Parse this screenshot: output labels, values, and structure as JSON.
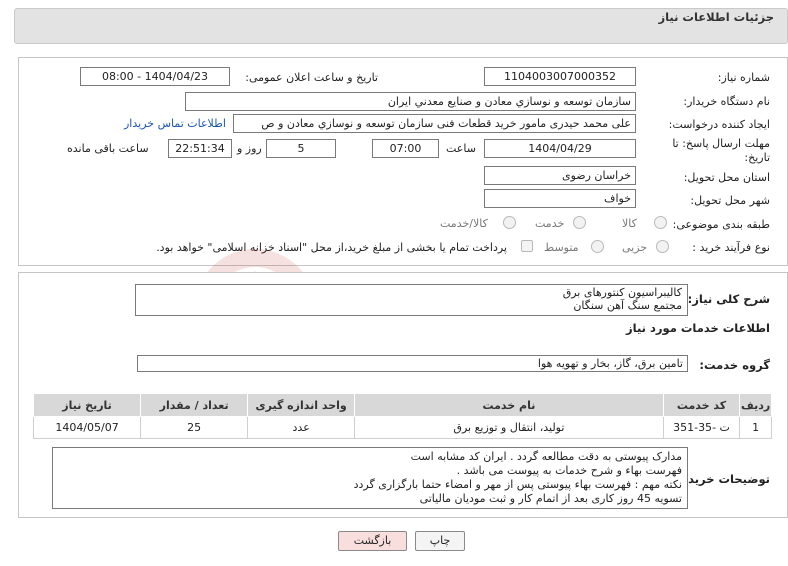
{
  "header": {
    "title": "جزئیات اطلاعات نیاز"
  },
  "need_info": {
    "need_number_label": "شماره نیاز:",
    "need_number": "1104003007000352",
    "announce_label": "تاریخ و ساعت اعلان عمومی:",
    "announce_value": "1404/04/23 - 08:00",
    "buyer_org_label": "نام دستگاه خریدار:",
    "buyer_org": "سازمان توسعه و نوسازي معادن و صنايع معدني ايران",
    "creator_label": "ایجاد کننده درخواست:",
    "creator": "علی محمد حیدری مامور خرید قطعات فنی سازمان توسعه و نوسازي معادن و ص",
    "contact_link": "اطلاعات تماس خریدار",
    "deadline_label_1": "مهلت ارسال پاسخ: تا",
    "deadline_label_2": "تاریخ:",
    "deadline_date": "1404/04/29",
    "time_label": "ساعت",
    "deadline_time": "07:00",
    "days_value": "5",
    "days_label": "روز و",
    "remaining_time": "22:51:34",
    "remaining_label": "ساعت باقی مانده",
    "province_label": "استان محل تحویل:",
    "province": "خراسان رضوی",
    "city_label": "شهر محل تحویل:",
    "city": "خواف",
    "category_label": "طبقه بندی موضوعی:",
    "category_options": [
      "کالا",
      "خدمت",
      "کالا/خدمت"
    ],
    "purchase_type_label": "نوع فرآیند خرید :",
    "purchase_options": [
      "جزیی",
      "متوسط"
    ],
    "payment_note": "پرداخت تمام یا بخشی از مبلغ خرید،از محل \"اسناد خزانه اسلامی\" خواهد بود."
  },
  "details": {
    "summary_label": "شرح کلی نیاز:",
    "summary_lines": [
      "کالیبراسیون کنتورهای برق",
      "مجتمع سنگ آهن سنگان"
    ],
    "services_title": "اطلاعات خدمات مورد نیاز",
    "service_group_label": "گروه خدمت:",
    "service_group": "تامین برق، گاز، بخار و تهویه هوا"
  },
  "table": {
    "headers": [
      "ردیف",
      "کد خدمت",
      "نام خدمت",
      "واحد اندازه گیری",
      "تعداد / مقدار",
      "تاریخ نیاز"
    ],
    "rows": [
      {
        "row": "1",
        "code": "ت -35-351",
        "name": "تولید، انتقال و توزیع برق",
        "unit": "عدد",
        "qty": "25",
        "date": "1404/05/07"
      }
    ]
  },
  "notes": {
    "label": "توضیحات خریدار:",
    "lines": [
      "مدارک پیوستی به دقت مطالعه گردد . ایران کد مشابه است",
      "فهرست بهاء و شرح خدمات به پیوست می باشد .",
      "نکته مهم : فهرست بهاء پیوستی پس از مهر و امضاء حتما بارگزاری گردد",
      "تسویه 45 روز کاری بعد از اتمام کار و ثبت مودیان مالیاتی"
    ]
  },
  "buttons": {
    "print": "چاپ",
    "back": "بازگشت"
  },
  "watermark": {
    "text": "AriaTender.net"
  },
  "colors": {
    "link": "#1a56b0",
    "back_button_bg": "#f9dede",
    "header_bg": "#e3e3e3",
    "watermark": "#c0392b"
  }
}
